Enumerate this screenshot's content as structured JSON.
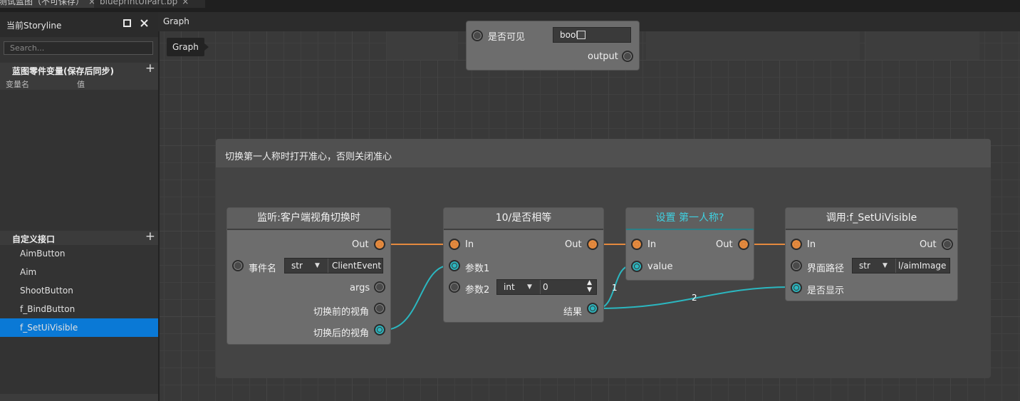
{
  "tabs": [
    {
      "label": "测试蓝图（不可保存）",
      "close": "×"
    },
    {
      "label": "blueprintUIPart.bp",
      "close": "×"
    }
  ],
  "left_panel": {
    "title": "当前Storyline",
    "search_placeholder": "Search...",
    "variables_section": {
      "title": "蓝图零件变量(保存后同步)",
      "col_name": "变量名",
      "col_value": "值"
    },
    "interfaces_section": {
      "title": "自定义接口",
      "items": [
        "AimButton",
        "Aim",
        "ShootButton",
        "f_BindButton",
        "f_SetUiVisible"
      ],
      "selected_index": 4
    }
  },
  "graph": {
    "header": "Graph",
    "tooltip": "Graph",
    "top_node": {
      "pin_label": "是否可见",
      "type": "bool",
      "output": "output"
    },
    "comment": "切换第一人称时打开准心，否则关闭准心",
    "nodes": {
      "listener": {
        "title": "监听:客户端视角切换时",
        "out": "Out",
        "event_label": "事件名",
        "event_type": "str",
        "event_value": "ClientEvent",
        "args": "args",
        "before_view": "切换前的视角",
        "after_view": "切换后的视角"
      },
      "equals": {
        "title": "10/是否相等",
        "in": "In",
        "out": "Out",
        "param1": "参数1",
        "param2": "参数2",
        "param2_type": "int",
        "param2_value": "0",
        "result": "结果"
      },
      "setter": {
        "title": "设置 第一人称?",
        "in": "In",
        "out": "Out",
        "value": "value"
      },
      "caller": {
        "title": "调用:f_SetUiVisible",
        "in": "In",
        "out": "Out",
        "path_label": "界面路径",
        "path_type": "str",
        "path_value": "l/aimImage",
        "visible_label": "是否显示"
      }
    },
    "wire_labels": [
      "1",
      "2"
    ]
  },
  "colors": {
    "exec_wire": "#e58a3e",
    "data_wire": "#2bb7c0",
    "selected": "#0a79d6",
    "setter_title": "#3fd0e0"
  }
}
